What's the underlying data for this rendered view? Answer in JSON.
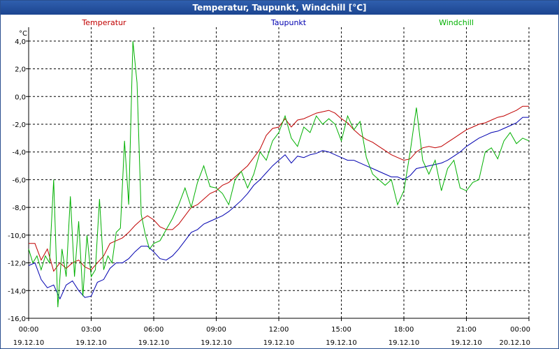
{
  "window": {
    "title": "Temperatur, Taupunkt, Windchill [°C]"
  },
  "chart_data": {
    "type": "line",
    "title": "Temperatur, Taupunkt, Windchill [°C]",
    "ylabel": "°C",
    "ylim": [
      -16,
      5
    ],
    "yticks": [
      "4,0",
      "2,0",
      "0,0",
      "-2,0",
      "-4,0",
      "-6,0",
      "-8,0",
      "-10,0",
      "-12,0",
      "-14,0",
      "-16,0"
    ],
    "xlim": [
      0,
      24
    ],
    "xticks": [
      {
        "time": "00:00",
        "date": "19.12.10"
      },
      {
        "time": "03:00",
        "date": "19.12.10"
      },
      {
        "time": "06:00",
        "date": "19.12.10"
      },
      {
        "time": "09:00",
        "date": "19.12.10"
      },
      {
        "time": "12:00",
        "date": "19.12.10"
      },
      {
        "time": "15:00",
        "date": "19.12.10"
      },
      {
        "time": "18:00",
        "date": "19.12.10"
      },
      {
        "time": "21:00",
        "date": "19.12.10"
      },
      {
        "time": "00:00",
        "date": "20.12.10"
      }
    ],
    "grid": true,
    "legend": "top",
    "series": [
      {
        "name": "Temperatur",
        "color": "#c00000",
        "x": [
          0,
          0.3,
          0.6,
          0.9,
          1.2,
          1.5,
          1.8,
          2.1,
          2.4,
          2.7,
          3.0,
          3.3,
          3.6,
          3.9,
          4.2,
          4.5,
          4.8,
          5.1,
          5.4,
          5.7,
          6.0,
          6.3,
          6.6,
          6.9,
          7.2,
          7.5,
          7.8,
          8.1,
          8.4,
          8.7,
          9.0,
          9.3,
          9.6,
          9.9,
          10.2,
          10.5,
          10.8,
          11.1,
          11.4,
          11.7,
          12.0,
          12.3,
          12.6,
          12.9,
          13.2,
          13.5,
          13.8,
          14.1,
          14.4,
          14.7,
          15.0,
          15.3,
          15.6,
          15.9,
          16.2,
          16.5,
          16.8,
          17.1,
          17.4,
          17.7,
          18.0,
          18.3,
          18.6,
          18.9,
          19.2,
          19.5,
          19.8,
          20.1,
          20.4,
          20.7,
          21.0,
          21.3,
          21.6,
          21.9,
          22.2,
          22.5,
          22.8,
          23.1,
          23.4,
          23.7,
          24.0
        ],
        "y": [
          -10.6,
          -10.6,
          -11.8,
          -11.0,
          -12.6,
          -12.0,
          -12.4,
          -12.0,
          -11.8,
          -12.3,
          -12.5,
          -12.0,
          -11.5,
          -10.6,
          -10.4,
          -10.2,
          -9.8,
          -9.3,
          -8.9,
          -8.6,
          -8.9,
          -9.4,
          -9.6,
          -9.6,
          -9.2,
          -8.6,
          -8.0,
          -7.8,
          -7.4,
          -7.0,
          -6.8,
          -6.4,
          -6.2,
          -5.8,
          -5.4,
          -5.0,
          -4.4,
          -3.8,
          -2.8,
          -2.3,
          -2.2,
          -1.6,
          -2.2,
          -1.7,
          -1.6,
          -1.4,
          -1.2,
          -1.1,
          -1.0,
          -1.2,
          -1.6,
          -1.9,
          -2.4,
          -2.8,
          -3.1,
          -3.3,
          -3.6,
          -3.9,
          -4.2,
          -4.4,
          -4.6,
          -4.5,
          -4.0,
          -3.7,
          -3.6,
          -3.7,
          -3.6,
          -3.3,
          -3.0,
          -2.7,
          -2.4,
          -2.2,
          -2.0,
          -1.9,
          -1.7,
          -1.5,
          -1.4,
          -1.2,
          -1.0,
          -0.7,
          -0.7
        ]
      },
      {
        "name": "Taupunkt",
        "color": "#0000b0",
        "x": [
          0,
          0.3,
          0.6,
          0.9,
          1.2,
          1.5,
          1.8,
          2.1,
          2.4,
          2.7,
          3.0,
          3.3,
          3.6,
          3.9,
          4.2,
          4.5,
          4.8,
          5.1,
          5.4,
          5.7,
          6.0,
          6.3,
          6.6,
          6.9,
          7.2,
          7.5,
          7.8,
          8.1,
          8.4,
          8.7,
          9.0,
          9.3,
          9.6,
          9.9,
          10.2,
          10.5,
          10.8,
          11.1,
          11.4,
          11.7,
          12.0,
          12.3,
          12.6,
          12.9,
          13.2,
          13.5,
          13.8,
          14.1,
          14.4,
          14.7,
          15.0,
          15.3,
          15.6,
          15.9,
          16.2,
          16.5,
          16.8,
          17.1,
          17.4,
          17.7,
          18.0,
          18.3,
          18.6,
          18.9,
          19.2,
          19.5,
          19.8,
          20.1,
          20.4,
          20.7,
          21.0,
          21.3,
          21.6,
          21.9,
          22.2,
          22.5,
          22.8,
          23.1,
          23.4,
          23.7,
          24.0
        ],
        "y": [
          -12.2,
          -12.0,
          -13.2,
          -13.8,
          -13.6,
          -14.6,
          -13.6,
          -13.3,
          -14.0,
          -14.5,
          -14.4,
          -13.4,
          -13.2,
          -12.4,
          -12.0,
          -12.0,
          -11.7,
          -11.2,
          -10.8,
          -10.8,
          -11.2,
          -11.7,
          -11.8,
          -11.5,
          -11.0,
          -10.4,
          -9.8,
          -9.6,
          -9.2,
          -9.0,
          -8.8,
          -8.6,
          -8.3,
          -7.9,
          -7.5,
          -7.0,
          -6.4,
          -6.0,
          -5.5,
          -5.0,
          -4.6,
          -4.2,
          -4.8,
          -4.3,
          -4.4,
          -4.2,
          -4.1,
          -3.9,
          -4.0,
          -4.2,
          -4.4,
          -4.6,
          -4.6,
          -4.8,
          -5.0,
          -5.2,
          -5.4,
          -5.6,
          -5.8,
          -5.8,
          -6.0,
          -5.7,
          -5.2,
          -5.1,
          -5.0,
          -4.9,
          -4.8,
          -4.6,
          -4.3,
          -4.0,
          -3.6,
          -3.3,
          -3.0,
          -2.8,
          -2.6,
          -2.5,
          -2.3,
          -2.1,
          -1.9,
          -1.5,
          -1.5
        ]
      },
      {
        "name": "Windchill",
        "color": "#00b000",
        "x": [
          0,
          0.2,
          0.4,
          0.6,
          0.8,
          1.0,
          1.2,
          1.4,
          1.6,
          1.8,
          2.0,
          2.2,
          2.4,
          2.6,
          2.8,
          3.0,
          3.2,
          3.4,
          3.6,
          3.8,
          4.0,
          4.2,
          4.4,
          4.6,
          4.8,
          5.0,
          5.2,
          5.4,
          5.6,
          5.8,
          6.0,
          6.3,
          6.6,
          6.9,
          7.2,
          7.5,
          7.8,
          8.1,
          8.4,
          8.7,
          9.0,
          9.3,
          9.6,
          9.9,
          10.2,
          10.5,
          10.8,
          11.1,
          11.4,
          11.7,
          12.0,
          12.3,
          12.6,
          12.9,
          13.2,
          13.5,
          13.8,
          14.1,
          14.4,
          14.7,
          15.0,
          15.3,
          15.6,
          15.9,
          16.2,
          16.5,
          16.8,
          17.1,
          17.4,
          17.7,
          18.0,
          18.3,
          18.6,
          18.9,
          19.2,
          19.5,
          19.8,
          20.1,
          20.4,
          20.7,
          21.0,
          21.3,
          21.6,
          21.9,
          22.2,
          22.5,
          22.8,
          23.1,
          23.4,
          23.7,
          24.0
        ],
        "y": [
          -11.0,
          -12.0,
          -11.5,
          -12.5,
          -11.5,
          -12.0,
          -6.0,
          -15.2,
          -11.0,
          -13.0,
          -7.2,
          -13.0,
          -9.0,
          -14.4,
          -10.0,
          -13.0,
          -12.5,
          -7.4,
          -12.5,
          -11.5,
          -12.0,
          -9.8,
          -9.5,
          -3.2,
          -7.8,
          4.0,
          1.0,
          -8.5,
          -10.0,
          -11.0,
          -10.6,
          -10.4,
          -9.6,
          -8.8,
          -7.8,
          -6.6,
          -8.0,
          -6.2,
          -5.0,
          -6.5,
          -6.6,
          -7.0,
          -7.8,
          -6.0,
          -5.4,
          -6.6,
          -5.6,
          -4.0,
          -4.6,
          -3.2,
          -2.6,
          -1.4,
          -3.0,
          -3.6,
          -2.2,
          -2.6,
          -1.4,
          -2.0,
          -1.6,
          -2.0,
          -3.2,
          -1.4,
          -2.4,
          -1.8,
          -4.4,
          -5.6,
          -6.0,
          -6.4,
          -6.0,
          -7.8,
          -6.8,
          -4.0,
          -0.8,
          -4.6,
          -5.6,
          -4.6,
          -6.8,
          -5.2,
          -4.6,
          -6.6,
          -6.8,
          -6.2,
          -6.0,
          -4.0,
          -3.7,
          -4.5,
          -3.2,
          -2.6,
          -3.4,
          -3.0,
          -3.2
        ]
      }
    ]
  }
}
